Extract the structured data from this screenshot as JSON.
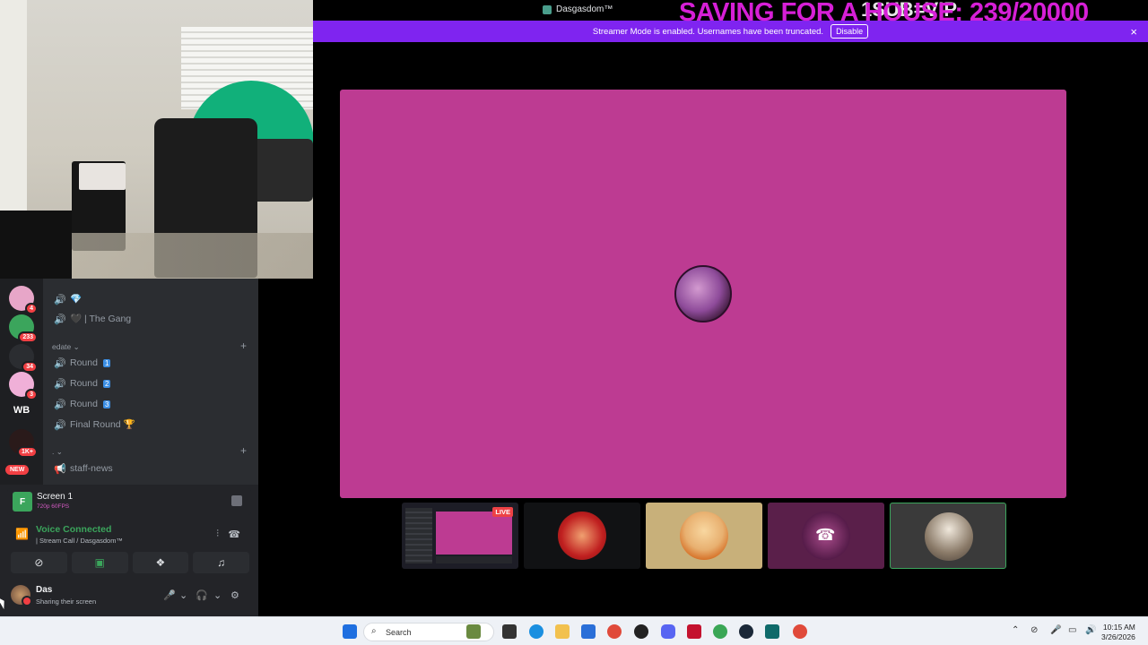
{
  "window": {
    "title": "Dasgasdom™"
  },
  "overlay": {
    "goal_text": "SAVING FOR A HOUSE: 239/20000",
    "sub_text": "1SUB=VIP"
  },
  "notice": {
    "message": "Streamer Mode is enabled. Usernames have been truncated.",
    "disable_label": "Disable",
    "close_icon": "×"
  },
  "stage": {
    "thumbnails": [
      {
        "id": "screen-share-thumb",
        "live_label": "LIVE"
      },
      {
        "id": "participant-red"
      },
      {
        "id": "participant-aang"
      },
      {
        "id": "participant-calling",
        "phone_icon": "☎"
      },
      {
        "id": "participant-soldier"
      }
    ]
  },
  "guilds": {
    "items": [
      {
        "badge": "4"
      },
      {
        "badge": "233"
      },
      {
        "badge": "34"
      },
      {
        "badge": "3"
      },
      {
        "label": "WB"
      },
      {
        "badge": "1K+"
      }
    ],
    "new_label": "NEW"
  },
  "channels": {
    "items": [
      {
        "name": "💎"
      },
      {
        "name": "🖤 | The Gang"
      }
    ],
    "category_edate": "edate ⌄",
    "edate_items": [
      {
        "name": "Round",
        "num": "1"
      },
      {
        "name": "Round",
        "num": "2"
      },
      {
        "name": "Round",
        "num": "3"
      },
      {
        "name": "Final Round 🏆"
      }
    ],
    "category_misc": ". ⌄",
    "misc_items": [
      {
        "name": "staff-news"
      }
    ],
    "add_icon": "+"
  },
  "screen_share": {
    "name": "Screen 1",
    "meta": "720p 60FPS"
  },
  "voice": {
    "status": "Voice Connected",
    "channel": "| Stream Call / Dasgasdom™"
  },
  "user": {
    "name": "Das",
    "status": "Sharing their screen"
  },
  "taskbar": {
    "search_placeholder": "Search",
    "time": "10:15 AM",
    "date": "3/26/2026"
  },
  "colors": {
    "stage_share_bg": "#bd3b92",
    "notice_bg": "#7f24f0",
    "voice_green": "#3ba55c",
    "overlay_text": "#d61fd6"
  }
}
